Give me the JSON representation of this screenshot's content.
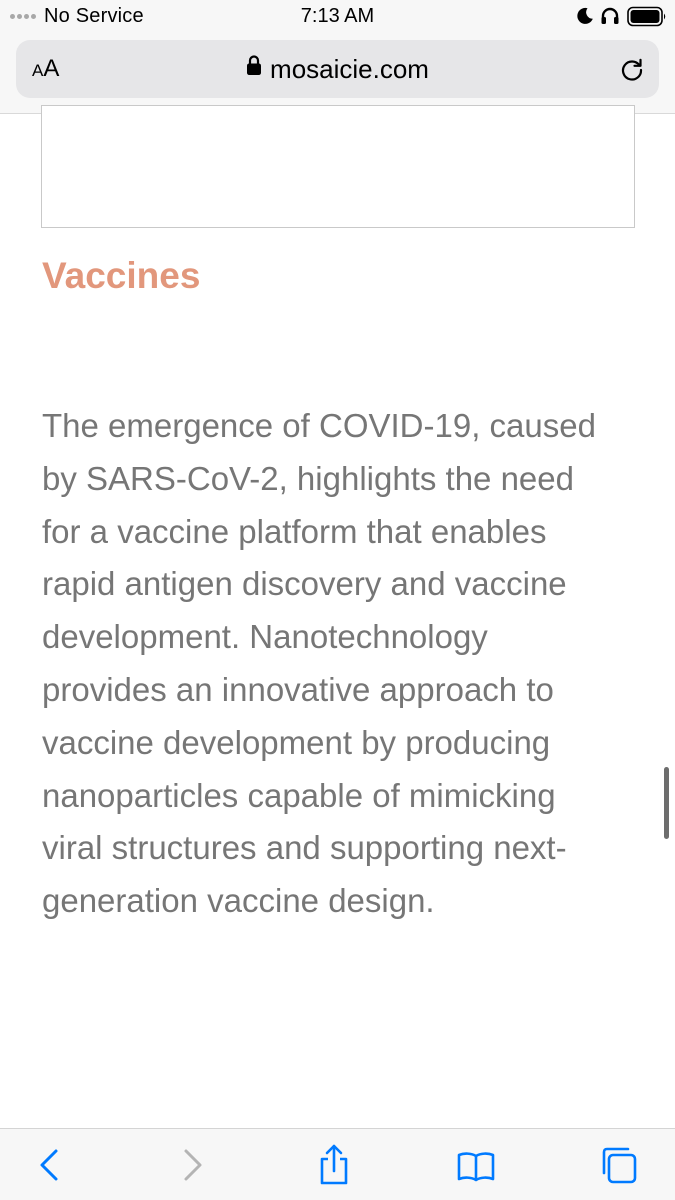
{
  "status_bar": {
    "carrier": "No Service",
    "time": "7:13 AM",
    "icons": [
      "signal-dots-icon",
      "moon-icon",
      "headphones-icon",
      "battery-icon"
    ]
  },
  "address_bar": {
    "text_size_small": "A",
    "text_size_large": "A",
    "url": "mosaicie.com",
    "icons": [
      "lock-icon",
      "reload-icon"
    ]
  },
  "page": {
    "heading": "Vaccines",
    "body": "The emergence of COVID-19, caused\nby SARS-CoV-2, highlights the need\nfor a vaccine platform that enables\nrapid antigen discovery and vaccine\ndevelopment.  Nanotechnology\nprovides an innovative approach to\nvaccine development by producing\nnanoparticles capable of mimicking\nviral structures and supporting next-\ngeneration vaccine design."
  },
  "bottom_toolbar": {
    "buttons": [
      "back-icon",
      "forward-icon",
      "share-icon",
      "bookmarks-icon",
      "tabs-icon"
    ]
  },
  "colors": {
    "accent_link": "#007aff",
    "heading": "#e2977c",
    "body_text": "#767676",
    "disabled": "#b4b4b4"
  }
}
